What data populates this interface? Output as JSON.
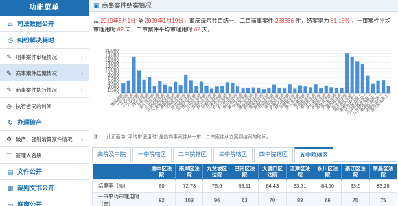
{
  "sidebar": {
    "title": "功能菜单",
    "items": [
      {
        "label": "司法数据公开",
        "icon": "scales",
        "type": "section"
      },
      {
        "label": "纠纷解决耗时",
        "icon": "clock",
        "type": "section"
      },
      {
        "label": "刑事案件审结情况",
        "icon": "gavel",
        "type": "sub",
        "chevron": "›"
      },
      {
        "label": "商事案件结案情况",
        "icon": "gavel",
        "type": "sub",
        "active": true,
        "chevron": "›"
      },
      {
        "label": "商事案件执行情况",
        "icon": "gavel",
        "type": "sub",
        "chevron": "›"
      },
      {
        "label": "执行合同的时间",
        "icon": "clock",
        "type": "sub"
      },
      {
        "label": "办理破产",
        "icon": "refresh",
        "type": "section"
      },
      {
        "label": "破产、强制清算案件情况",
        "icon": "gear",
        "type": "sub",
        "chevron": "›"
      },
      {
        "label": "管理人名册",
        "icon": "list",
        "type": "sub"
      },
      {
        "label": "文件公开",
        "icon": "folder",
        "type": "section"
      },
      {
        "label": "裁判文书公开",
        "icon": "document",
        "type": "section"
      },
      {
        "label": "庭审公开",
        "icon": "monitor",
        "type": "section"
      }
    ]
  },
  "panel": {
    "title": "商事案件结案情况",
    "icon": "document-icon"
  },
  "summary": {
    "p1": "从 ",
    "date_from": "2019年6月1日",
    "p2": " 至 ",
    "date_to": "2020年1月19日",
    "p3": "，重庆法院共审结一、二审商事案件 ",
    "total": "238366",
    "p4": " 件，结案率为 ",
    "rate": "81.18%",
    "p5": " ，一审案件平均审理用时 ",
    "first_days": "82",
    "p6": " 天，二审案件平均审理用时 ",
    "second_days": "62",
    "p7": " 天。"
  },
  "chart_data": {
    "type": "bar",
    "ylim": [
      0,
      21000
    ],
    "yticks": [
      0,
      1500,
      3000,
      4500,
      6000,
      7500,
      9000,
      10500,
      12000,
      13500,
      15000,
      16500,
      18000,
      19500,
      21000
    ],
    "grid": true,
    "bar_color": "#4a90d9",
    "categories": [
      "重庆高院",
      "一中法院",
      "二中法院",
      "三中法院",
      "四中法院",
      "五中法院",
      "渝中区法院",
      "江北区法院",
      "沙坪坝区法院",
      "九龙坡区法院",
      "南岸区法院",
      "北碚区法院",
      "渝北区法院",
      "巴南区法院",
      "大渡口区法院",
      "万州区法院",
      "涪陵区法院",
      "黔江区法院",
      "长寿区法院",
      "江津区法院",
      "合川区法院",
      "永川区法院",
      "南川区法院",
      "綦江区法院",
      "大足区法院",
      "璧山区法院",
      "铜梁区法院",
      "潼南区法院",
      "荣昌区法院",
      "开州区法院",
      "梁平区法院",
      "武隆区法院",
      "城口县法院",
      "丰都县法院",
      "垫江县法院",
      "忠县法院",
      "云阳县法院",
      "奉节县法院",
      "巫山县法院",
      "巫溪县法院",
      "石柱县法院",
      "秀山县法院",
      "酉阳县法院",
      "彭水县法院",
      "两江新区法院",
      "渝中区法院二",
      "江北区法院二",
      "沙坪坝区法院二",
      "九龙坡区法院二",
      "南岸区法院二",
      "北碚区法院二",
      "渝北区法院二"
    ],
    "values": [
      4700,
      6200,
      18000,
      11000,
      6500,
      8000,
      3500,
      5800,
      4200,
      3200,
      5500,
      4000,
      9200,
      6300,
      3400,
      5600,
      3800,
      2200,
      3300,
      3600,
      5300,
      4800,
      3300,
      2300,
      2400,
      2800,
      2500,
      2000,
      2600,
      4200,
      2700,
      2300,
      4300,
      2200,
      3900,
      3300,
      2900,
      4300,
      2700,
      3800,
      2900,
      2500,
      2600,
      19600,
      18000,
      15800,
      14600,
      8600,
      4500,
      6200,
      6400,
      3500
    ]
  },
  "note": "注：1.此页面中 \"平均审理用时\" 是指商事案件从一审、二审案件从立案到结案的时间。",
  "tabs": [
    "高院及中院",
    "一中院辖区",
    "二中院辖区",
    "三中院辖区",
    "四中院辖区",
    "五中院辖区"
  ],
  "active_tab": 5,
  "table": {
    "headers": [
      "",
      "渝中区法院",
      "南岸区法院",
      "九龙坡区法院",
      "巴南区法院",
      "大渡口区法院",
      "江津区法院",
      "永川区法院",
      "綦江区法院",
      "荣昌区法院"
    ],
    "rows": [
      {
        "label": "结案率（%）",
        "values": [
          "80",
          "72.73",
          "78.6",
          "83.11",
          "84.43",
          "83.71",
          "84.56",
          "83.6",
          "83.28"
        ]
      },
      {
        "label": "一审平均审理用时（天）",
        "values": [
          "82",
          "103",
          "96",
          "63",
          "70",
          "83",
          "66",
          "75",
          "75"
        ]
      }
    ]
  }
}
